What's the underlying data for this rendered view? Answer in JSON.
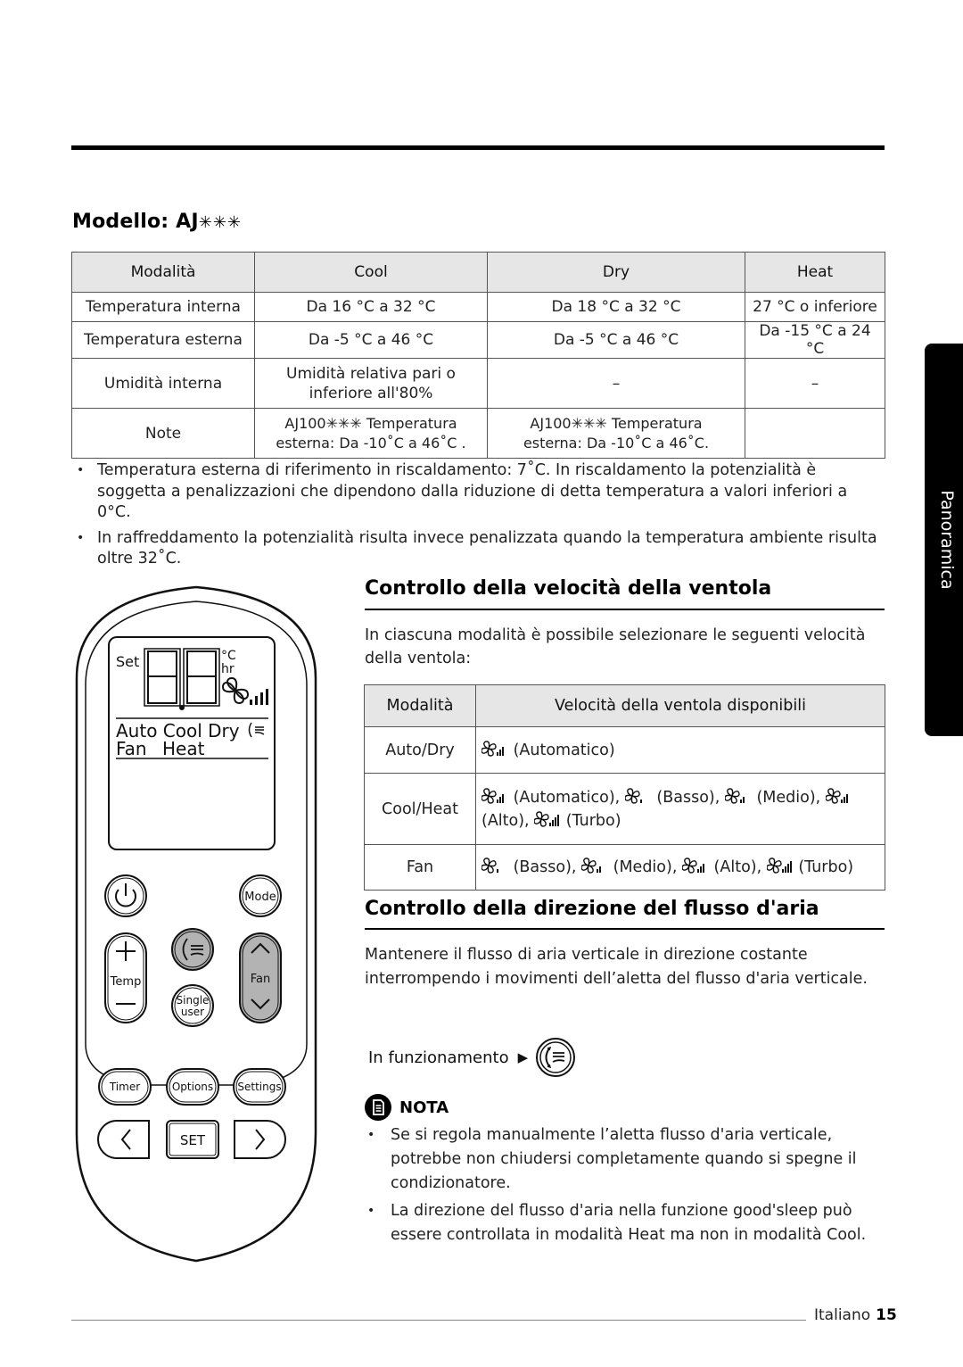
{
  "page": {
    "section_tab": "Panoramica",
    "footer": {
      "language": "Italiano",
      "page_number": "15"
    }
  },
  "model": {
    "title_prefix": "Modello: AJ",
    "title_stars": "✳✳✳",
    "table": {
      "headers": [
        "Modalità",
        "Cool",
        "Dry",
        "Heat"
      ],
      "rows": [
        {
          "label": "Temperatura interna",
          "cool": "Da 16 °C a 32 °C",
          "dry": "Da 18 °C a 32 °C",
          "heat": "27 °C o inferiore"
        },
        {
          "label": "Temperatura esterna",
          "cool": "Da -5 °C a 46 °C",
          "dry": "Da -5 °C a 46 °C",
          "heat": "Da -15 °C a 24 °C"
        },
        {
          "label": "Umidità interna",
          "cool_line1": "Umidità relativa pari o",
          "cool_line2": "inferiore all'80%",
          "dry": "–",
          "heat": "–"
        },
        {
          "label": "Note",
          "cool_line1": "AJ100✳✳✳ Temperatura",
          "cool_line2": "esterna: Da -10˚C a 46˚C .",
          "dry_line1": "AJ100✳✳✳ Temperatura",
          "dry_line2": "esterna: Da -10˚C a 46˚C.",
          "heat": ""
        }
      ]
    },
    "notes": [
      "Temperatura esterna di riferimento in riscaldamento: 7˚C. In riscaldamento la potenzialità è soggetta a penalizzazioni che dipendono dalla riduzione di detta temperatura a valori inferiori a 0°C.",
      "In raffreddamento la potenzialità risulta invece penalizzata quando la temperatura ambiente risulta oltre 32˚C."
    ]
  },
  "fan_speed": {
    "heading": "Controllo della velocità della ventola",
    "intro": "In ciascuna modalità è possibile selezionare le seguenti velocità della ventola:",
    "table": {
      "headers": [
        "Modalità",
        "Velocità della ventola disponibili"
      ],
      "rows": [
        {
          "mode": "Auto/Dry",
          "speeds": [
            {
              "icon": "fan-auto-icon",
              "label": "(Automatico)"
            }
          ]
        },
        {
          "mode": "Cool/Heat",
          "speeds": [
            {
              "icon": "fan-auto-icon",
              "label": "(Automatico),"
            },
            {
              "icon": "fan-low-icon",
              "label": "(Basso),"
            },
            {
              "icon": "fan-medium-icon",
              "label": "(Medio),"
            },
            {
              "icon": "fan-high-icon",
              "label": "(Alto),"
            },
            {
              "icon": "fan-turbo-icon",
              "label": "(Turbo)"
            }
          ]
        },
        {
          "mode": "Fan",
          "speeds": [
            {
              "icon": "fan-low-icon",
              "label": "(Basso),"
            },
            {
              "icon": "fan-medium-icon",
              "label": "(Medio),"
            },
            {
              "icon": "fan-high-icon",
              "label": "(Alto),"
            },
            {
              "icon": "fan-turbo-icon",
              "label": "(Turbo)"
            }
          ]
        }
      ]
    }
  },
  "airflow": {
    "heading": "Controllo della direzione del flusso d'aria",
    "intro": "Mantenere il flusso di aria verticale in direzione costante interrompendo i movimenti dell’aletta del flusso d'aria verticale.",
    "operation_label": "In funzionamento",
    "operation_arrow": "▶",
    "nota_label": "NOTA",
    "nota_items": [
      "Se si regola manualmente l’aletta flusso d'aria verticale, potrebbe non chiudersi completamente quando si spegne il condizionatore.",
      "La direzione del flusso d'aria nella funzione good'sleep può essere controllata in modalità Heat ma non in modalità Cool."
    ]
  },
  "remote": {
    "display": {
      "set_label": "Set",
      "digits": "8.8",
      "unit_c": "°C",
      "unit_hr": "hr",
      "modes_line1": "Auto Cool Dry",
      "modes_line2_a": "Fan",
      "modes_line2_b": "Heat"
    },
    "buttons": {
      "mode": "Mode",
      "temp": "Temp",
      "fan": "Fan",
      "single_user_1": "Single",
      "single_user_2": "user",
      "timer": "Timer",
      "options": "Options",
      "settings": "Settings",
      "set": "SET"
    }
  }
}
